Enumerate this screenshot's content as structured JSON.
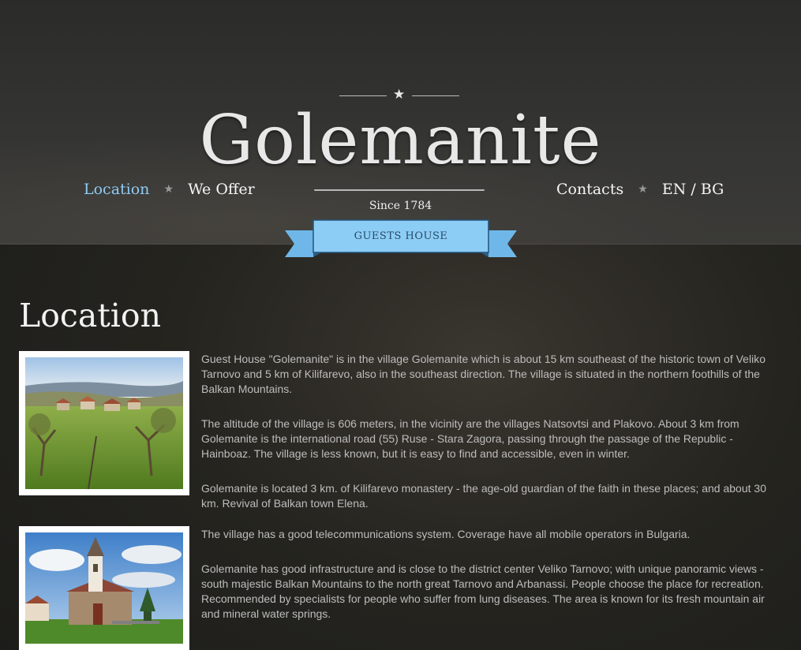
{
  "site": {
    "brand": "Golemanite",
    "since": "Since 1784",
    "ribbon": "GUESTS HOUSE"
  },
  "nav": {
    "left": [
      {
        "label": "Location",
        "active": true
      },
      {
        "label": "We Offer",
        "active": false
      }
    ],
    "right": [
      {
        "label": "Contacts"
      },
      {
        "label": "EN / BG"
      }
    ],
    "separator_icon": "star-icon"
  },
  "colors": {
    "accent": "#8ecbf5",
    "ribbon": "#8ccdf6",
    "text": "#bdbdbd"
  },
  "main": {
    "title": "Location",
    "photos": [
      {
        "icon": "village-landscape-photo"
      },
      {
        "icon": "church-photo"
      }
    ],
    "paragraphs": [
      "Guest House \"Golemanite\" is in the village Golemanite which is about 15 km southeast of the historic town of Veliko Tarnovo and 5 km of Kilifarevo, also in the southeast direction. The village is situated in the northern foothills of the Balkan Mountains.",
      "The altitude of the village is 606 meters, in the vicinity are the villages Natsovtsi and Plakovo. About 3 km from Golemanite is the international road (55) Ruse - Stara Zagora, passing through the passage of the Republic - Hainboaz. The village is less known, but it is easy to find and accessible, even in winter.",
      "Golemanite is located 3 km. of Kilifarevo monastery - the age-old guardian of the faith in these places; and about 30 km. Revival of Balkan town Elena.",
      "The village has a good telecommunications system. Coverage have all mobile operators in Bulgaria.",
      "Golemanite has good infrastructure and is close to the district center Veliko Tarnovo; with unique panoramic views - south majestic Balkan Mountains to the north great Tarnovo and Arbanassi. People choose the place for recreation. Recommended by specialists for people who suffer from lung diseases. The area is known for its fresh mountain air and mineral water springs."
    ]
  }
}
